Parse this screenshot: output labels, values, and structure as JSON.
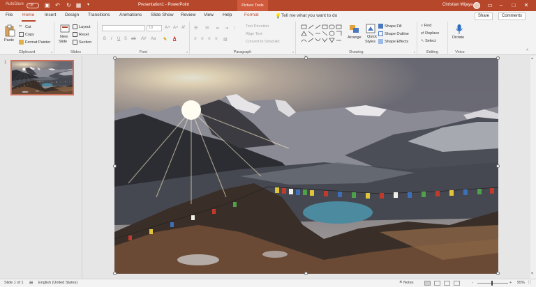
{
  "titlebar": {
    "autosave_label": "AutoSave",
    "autosave_state": "Off",
    "title": "Presentation1 - PowerPoint",
    "context_tab": "Picture Tools",
    "user": "Christian Wijaya",
    "accent_color": "#b7472a"
  },
  "tabs": [
    "File",
    "Home",
    "Insert",
    "Design",
    "Transitions",
    "Animations",
    "Slide Show",
    "Review",
    "View",
    "Help",
    "Format"
  ],
  "active_tab": "Home",
  "tellme": "Tell me what you want to do",
  "share_label": "Share",
  "comments_label": "Comments",
  "ribbon": {
    "clipboard": {
      "label": "Clipboard",
      "paste": "Paste",
      "cut": "Cut",
      "copy": "Copy",
      "format_painter": "Format Painter"
    },
    "slides": {
      "label": "Slides",
      "new_slide": "New",
      "new_slide_2": "Slide",
      "layout": "Layout",
      "reset": "Reset",
      "section": "Section"
    },
    "font": {
      "label": "Font",
      "size": "18"
    },
    "paragraph": {
      "label": "Paragraph",
      "text_direction": "Text Direction",
      "align_text": "Align Text",
      "smartart": "Convert to SmartArt"
    },
    "drawing": {
      "label": "Drawing",
      "arrange": "Arrange",
      "quick_styles": "Quick",
      "quick_styles_2": "Styles",
      "shape_fill": "Shape Fill",
      "shape_outline": "Shape Outline",
      "shape_effects": "Shape Effects"
    },
    "editing": {
      "label": "Editing",
      "find": "Find",
      "replace": "Replace",
      "select": "Select"
    },
    "voice": {
      "label": "Voice",
      "dictate": "Dictate"
    }
  },
  "thumbnail": {
    "number": "1"
  },
  "statusbar": {
    "slide_info": "Slide 1 of 1",
    "language": "English (United States)",
    "notes": "Notes",
    "zoom_minus": "-",
    "zoom_plus": "+",
    "zoom": "95%"
  }
}
